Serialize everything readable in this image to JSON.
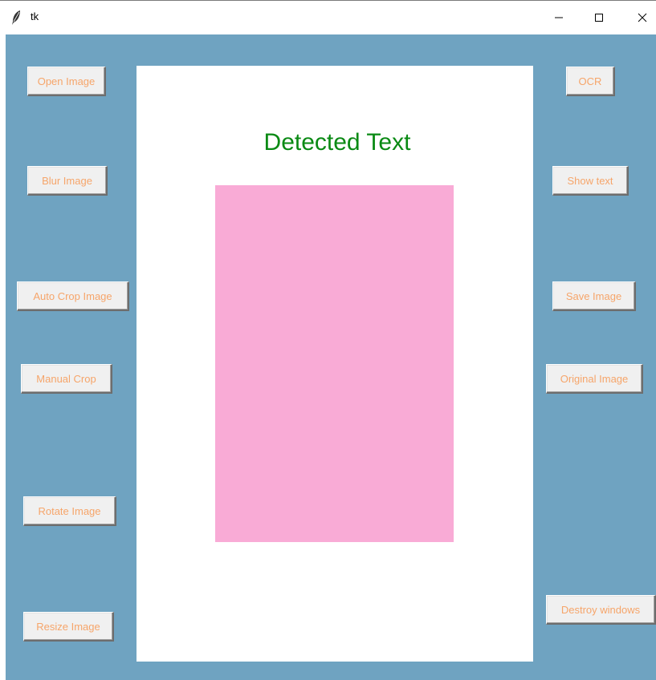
{
  "window": {
    "title": "tk",
    "background_color": "#6fa3c1"
  },
  "canvas": {
    "heading": "Detected Text",
    "heading_color": "#0a8a14",
    "image_color": "#f9abd6"
  },
  "buttons_left": {
    "open_image": "Open Image",
    "blur_image": "Blur Image",
    "auto_crop_image": "Auto Crop Image",
    "manual_crop": "Manual Crop",
    "rotate_image": "Rotate Image",
    "resize_image": "Resize Image"
  },
  "buttons_right": {
    "ocr": "OCR",
    "show_text": "Show text",
    "save_image": "Save Image",
    "original_image": "Original Image",
    "destroy_windows": "Destroy windows"
  },
  "button_text_color": "#f6a56a",
  "icons": {
    "app": "feather-icon",
    "minimize": "minimize-icon",
    "maximize": "maximize-icon",
    "close": "close-icon"
  }
}
